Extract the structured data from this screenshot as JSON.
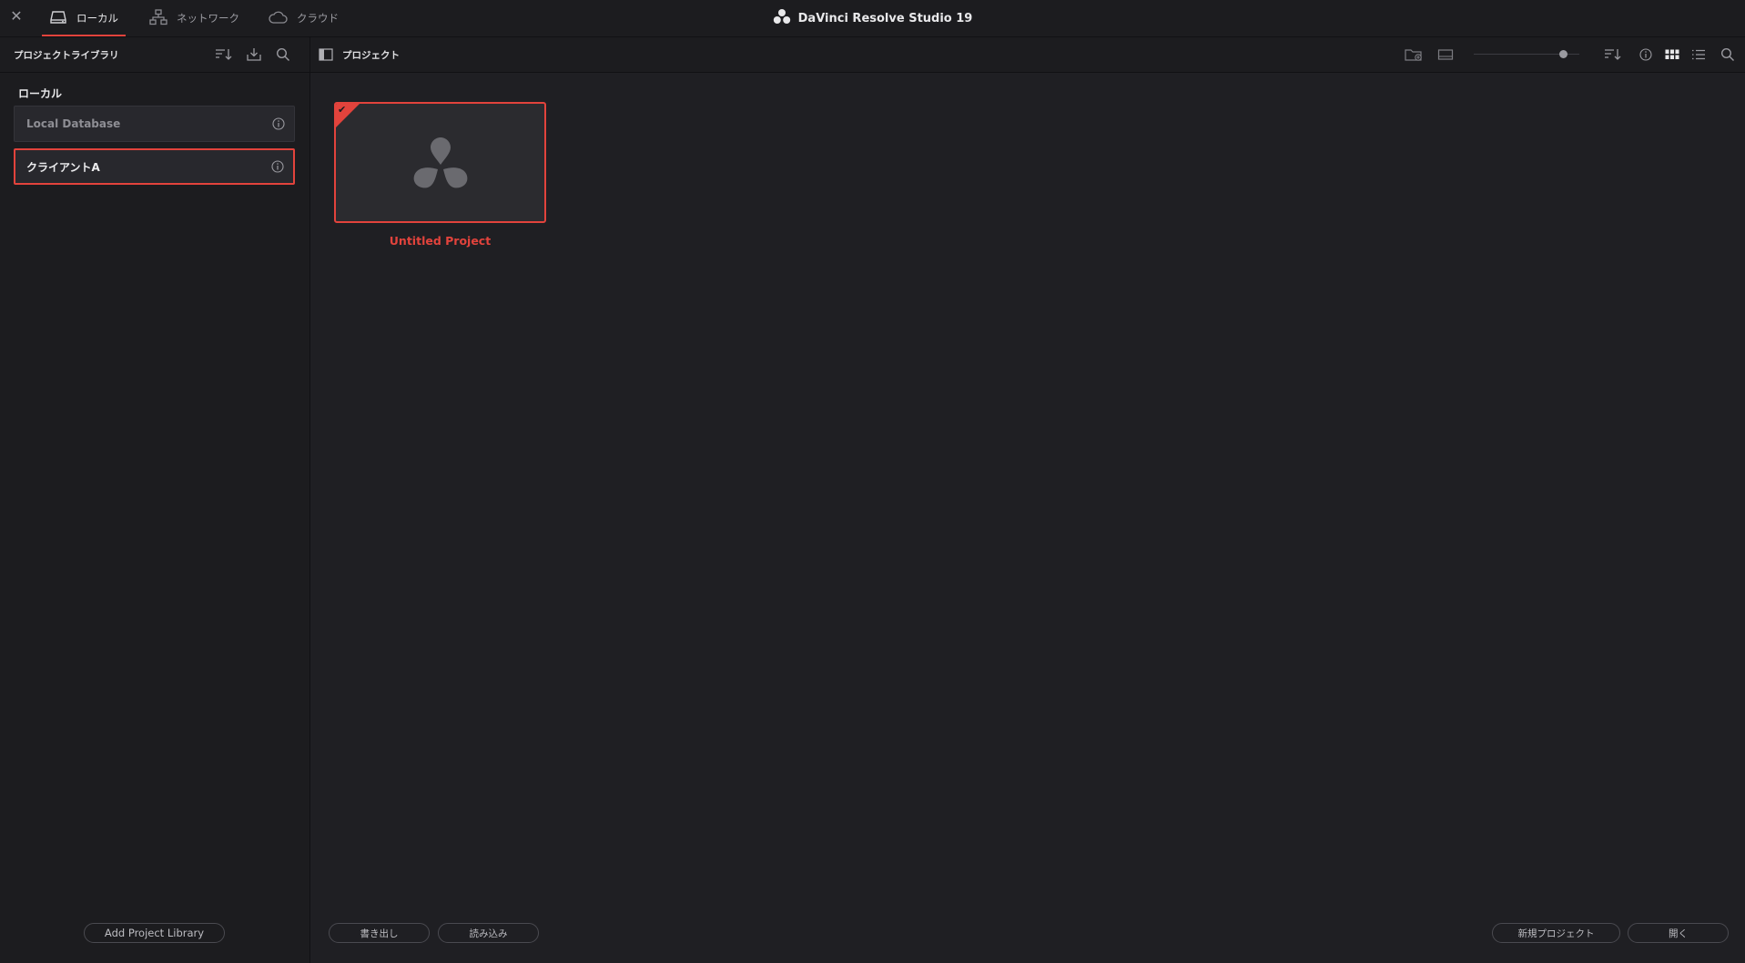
{
  "window": {
    "close_glyph": "✕",
    "app_title": "DaVinci Resolve Studio 19",
    "logo_icon": "davinci-logo-icon"
  },
  "tabs": [
    {
      "label": "ローカル",
      "icon": "drive-icon",
      "active": true
    },
    {
      "label": "ネットワーク",
      "icon": "network-icon",
      "active": false
    },
    {
      "label": "クラウド",
      "icon": "cloud-icon",
      "active": false
    }
  ],
  "sidebar": {
    "title": "プロジェクトライブラリ",
    "section_label": "ローカル",
    "libraries": [
      {
        "label": "Local Database",
        "selected": false
      },
      {
        "label": "クライアントA",
        "selected": true
      }
    ],
    "add_button": "Add Project Library"
  },
  "main": {
    "title": "プロジェクト",
    "zoom_level": 0.85,
    "projects": [
      {
        "name": "Untitled Project",
        "selected": true
      }
    ],
    "buttons": {
      "export": "書き出し",
      "import": "読み込み",
      "new_project": "新規プロジェクト",
      "open": "開く"
    }
  },
  "colors": {
    "accent": "#e2433c",
    "background": "#1f1f23",
    "panel": "#1c1c1f"
  }
}
